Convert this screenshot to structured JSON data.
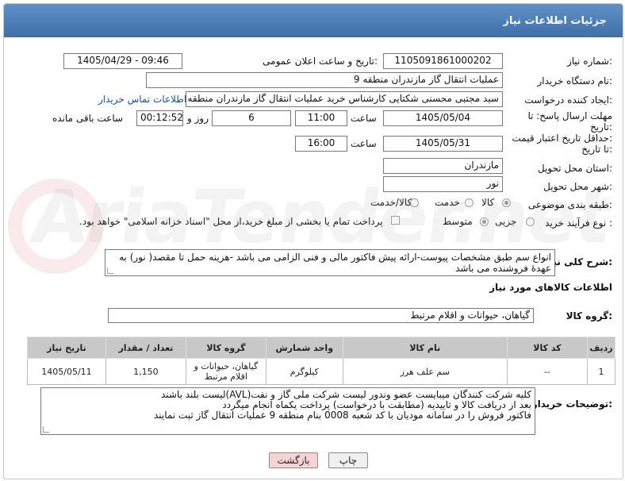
{
  "header": {
    "title": "جزئیات اطلاعات نیاز"
  },
  "fields": {
    "need_number_label": "شماره نیاز:",
    "need_number": "1105091861000202",
    "announce_label": "تاریخ و ساعت اعلان عمومی:",
    "announce_value": "1405/04/29 - 09:46",
    "buyer_label": "نام دستگاه خریدار:",
    "buyer_value": "عملیات انتقال گاز مازندران منطقه 9",
    "creator_label": "ایجاد کننده درخواست:",
    "creator_value": "سید مجتبی محسنی شکتایی کارشناس خرید عملیات انتقال گاز مازندران منطقه 9",
    "contact_link": "اطلاعات تماس خریدار",
    "deadline_label_1": "مهلت ارسال پاسخ: تا",
    "deadline_label_2": "تاریخ:",
    "deadline_date": "1405/05/04",
    "time_label": "ساعت",
    "deadline_time": "11:00",
    "days_value": "6",
    "days_label": "روز و",
    "remaining_time": "00:12:52",
    "remaining_label": "ساعت باقی مانده",
    "validity_label_1": "حداقل تاریخ اعتبار قیمت:",
    "validity_label_2": "تا تاریخ:",
    "validity_date": "1405/05/31",
    "validity_time_label": "ساعت",
    "validity_time": "16:00",
    "province_label": "استان محل تحویل:",
    "province_value": "مازندران",
    "city_label": "شهر محل تحویل:",
    "city_value": "نور",
    "category_label": "طبقه بندی موضوعی:",
    "category_options": [
      "کالا",
      "خدمت",
      "کالا/خدمت"
    ],
    "category_selected": "کالا",
    "process_label": "نوع فرآیند خرید :",
    "process_options": [
      "جزیی",
      "متوسط"
    ],
    "process_selected": "متوسط",
    "payment_note": "پرداخت تمام یا بخشی از مبلغ خرید،از محل \"اسناد خزانه اسلامی\" خواهد بود."
  },
  "description": {
    "label": "شرح کلی نیاز:",
    "text": "انواع سم طبق مشخصات پیوست-ارائه پیش فاکتور مالی و فنی الزامی می باشد -هزینه حمل تا مقصد( نور) به عهدهٔ فروشنده می باشد"
  },
  "goods_section": {
    "title": "اطلاعات کالاهای مورد نیاز",
    "group_label": "گروه کالا:",
    "group_value": "گیاهان، حیوانات و اقلام مرتبط",
    "columns": [
      "ردیف",
      "کد کالا",
      "نام کالا",
      "واحد شمارش",
      "گروه کالا",
      "تعداد / مقدار",
      "تاریخ نیاز"
    ],
    "rows": [
      [
        "1",
        "--",
        "سم علف هرز",
        "کیلوگرم",
        "گیاهان، حیوانات و اقلام مرتبط",
        "1,150",
        "1405/05/11"
      ]
    ]
  },
  "buyer_notes": {
    "label": "توضیحات خریدار:",
    "lines": [
      "کلیه شرکت کنندگان میبایست عضو وندور لیست شرکت ملی گاز و نفت(AVL)لیست بلند باشند",
      "بعد از دریافت کالا و تاییدیه (مطابقت با درخواست) پرداخت یکماه انجام میگردد",
      "فاکتور فروش را در سامانه مودیان با کد شعبه 0008 بنام منطقه 9 عملیات انتقال گاز ثبت نمایند"
    ]
  },
  "buttons": {
    "print": "چاپ",
    "back": "بازگشت"
  },
  "colors": {
    "header": "#4a7cb8",
    "back_button": "#f7d4d4",
    "print_button": "#f0f0f0"
  }
}
